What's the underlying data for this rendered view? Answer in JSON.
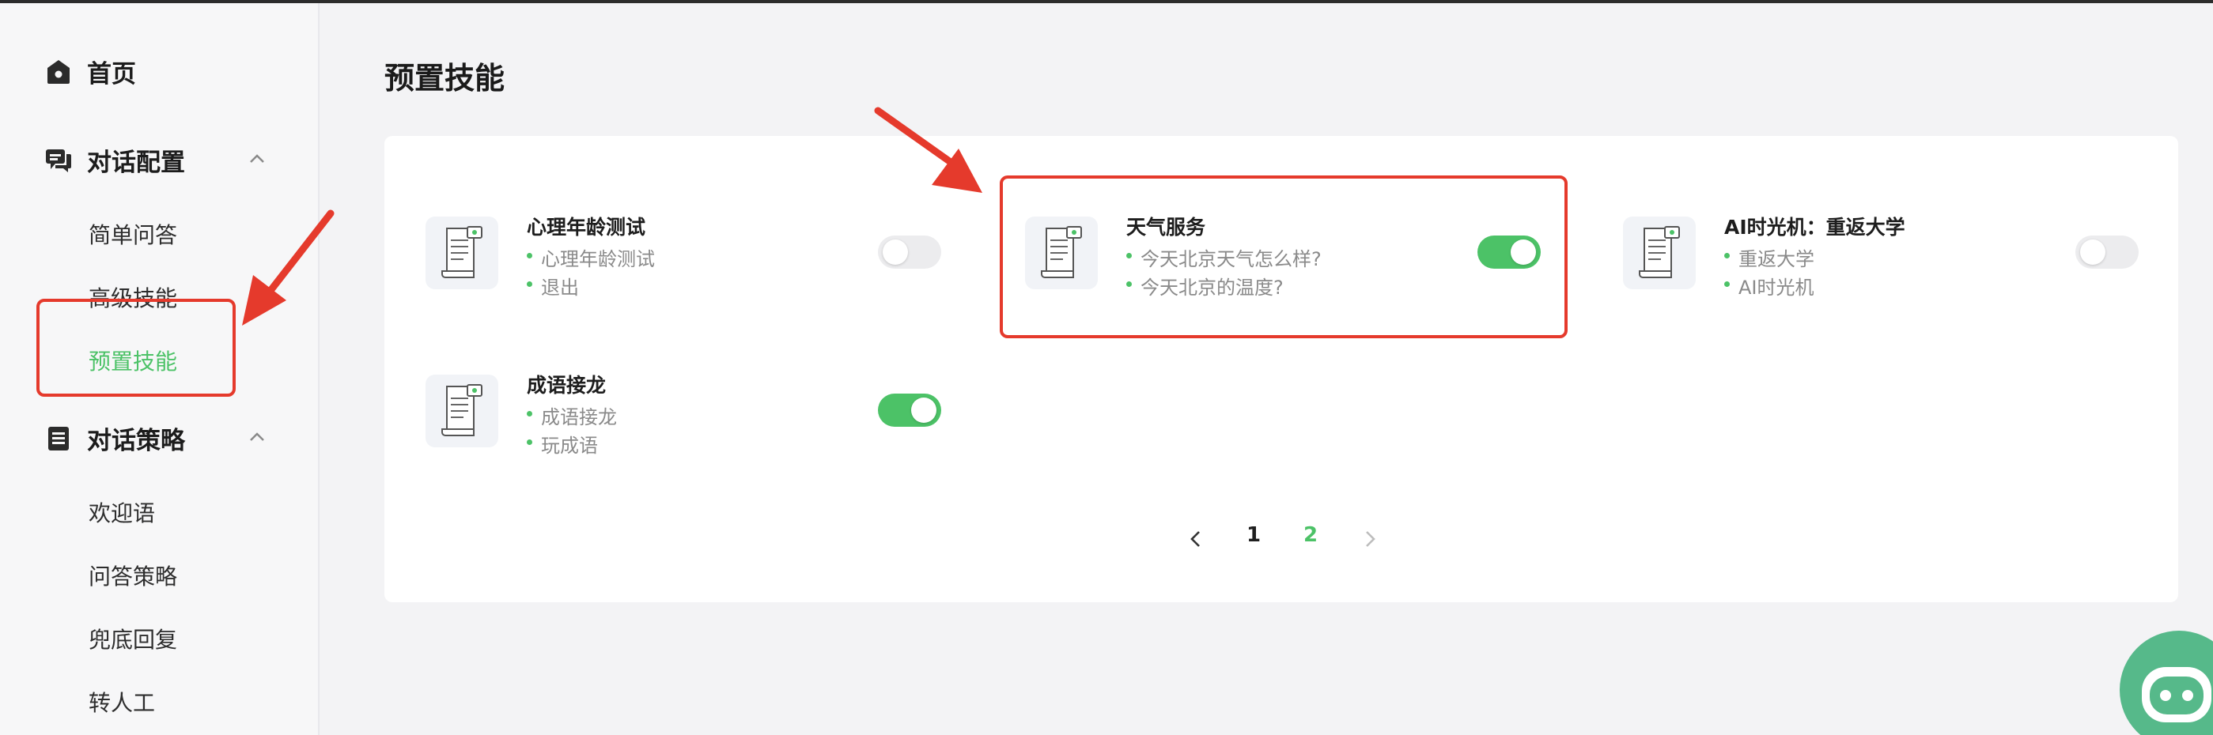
{
  "sidebar": {
    "home_label": "首页",
    "dialog_config": {
      "label": "对话配置",
      "items": [
        "简单问答",
        "高级技能",
        "预置技能"
      ]
    },
    "dialog_strategy": {
      "label": "对话策略",
      "items": [
        "欢迎语",
        "问答策略",
        "兜底回复",
        "转人工"
      ]
    },
    "active_item": "预置技能"
  },
  "main": {
    "title": "预置技能",
    "skills": [
      {
        "title": "心理年龄测试",
        "examples": [
          "心理年龄测试",
          "退出"
        ],
        "enabled": false
      },
      {
        "title": "天气服务",
        "examples": [
          "今天北京天气怎么样?",
          "今天北京的温度?"
        ],
        "enabled": true
      },
      {
        "title": "AI时光机：重返大学",
        "examples": [
          "重返大学",
          "AI时光机"
        ],
        "enabled": false
      },
      {
        "title": "成语接龙",
        "examples": [
          "成语接龙",
          "玩成语"
        ],
        "enabled": true
      }
    ],
    "pagination": {
      "pages": [
        "1",
        "2"
      ],
      "current": "2"
    }
  },
  "colors": {
    "accent": "#4cc267",
    "annotation": "#e53a2c"
  },
  "icons": {
    "home": "home-icon",
    "chat": "chat-icon",
    "list": "list-icon",
    "chevron": "chevron-up-icon",
    "skill": "document-icon"
  }
}
